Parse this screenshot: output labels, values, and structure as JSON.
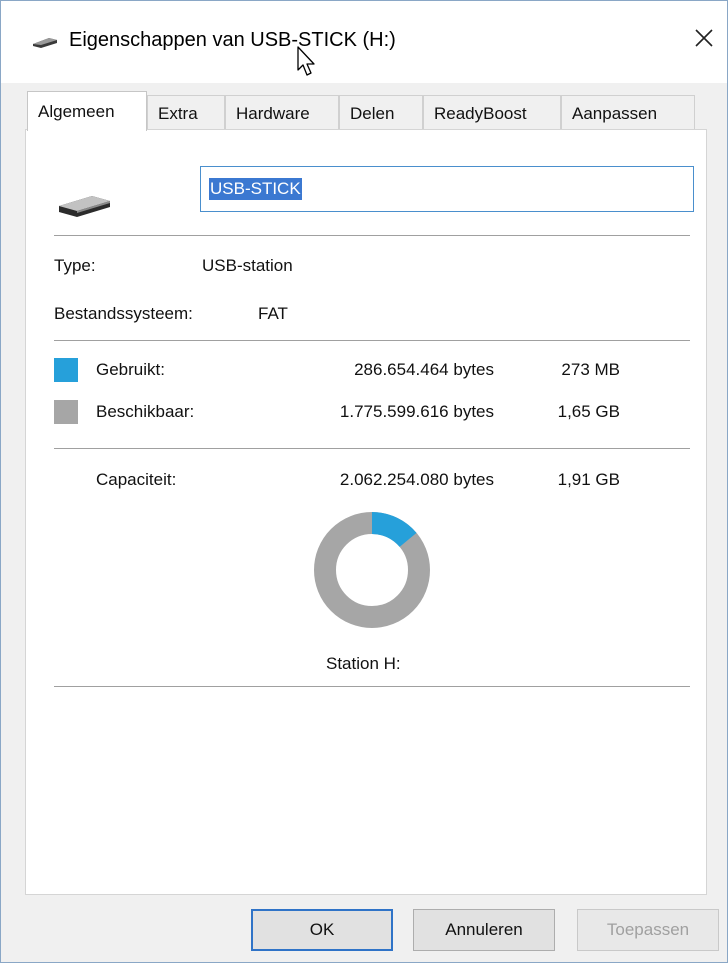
{
  "window": {
    "title": "Eigenschappen van USB-STICK (H:)"
  },
  "tabs": [
    {
      "label": "Algemeen",
      "active": true
    },
    {
      "label": "Extra"
    },
    {
      "label": "Hardware"
    },
    {
      "label": "Delen"
    },
    {
      "label": "ReadyBoost"
    },
    {
      "label": "Aanpassen"
    }
  ],
  "general": {
    "name_value": "USB-STICK",
    "type_label": "Type:",
    "type_value": "USB-station",
    "fs_label": "Bestandssysteem:",
    "fs_value": "FAT",
    "used_label": "Gebruikt:",
    "used_bytes": "286.654.464 bytes",
    "used_size": "273 MB",
    "free_label": "Beschikbaar:",
    "free_bytes": "1.775.599.616 bytes",
    "free_size": "1,65 GB",
    "capacity_label": "Capaciteit:",
    "capacity_bytes": "2.062.254.080 bytes",
    "capacity_size": "1,91 GB",
    "drive_label": "Station H:"
  },
  "usage": {
    "used_fraction": 0.139,
    "used_color": "#26a0da",
    "free_color": "#a6a6a6"
  },
  "buttons": {
    "ok": "OK",
    "cancel": "Annuleren",
    "apply": "Toepassen"
  },
  "icons": {
    "title": "usb-drive-icon",
    "close": "close-icon",
    "drive": "usb-drive-icon",
    "cursor": "mouse-cursor-icon"
  }
}
